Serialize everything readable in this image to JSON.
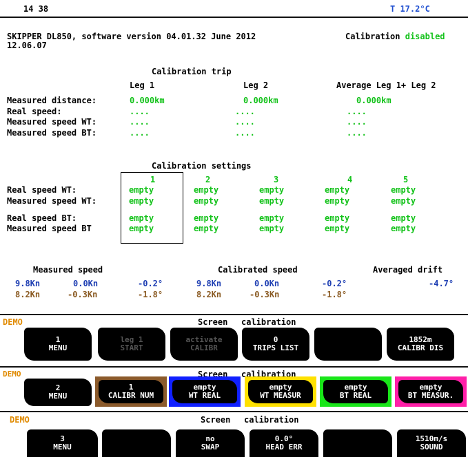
{
  "status": {
    "time": "14 38",
    "temperature": "T 17.2°C"
  },
  "header": {
    "software_line1": "SKIPPER DL850, software version 04.01.32 June 2012",
    "software_line2": "12.06.07",
    "calibration_label": "Calibration",
    "calibration_state": "disabled"
  },
  "trip": {
    "title": "Calibration trip",
    "col_headers": [
      "Leg 1",
      "Leg 2",
      "Average Leg 1+ Leg 2"
    ],
    "rows": [
      {
        "label": "Measured distance:",
        "values": [
          "0.000km",
          "0.000km",
          "0.000km"
        ]
      },
      {
        "label": "Real speed:",
        "values": [
          "....",
          "....",
          "...."
        ]
      },
      {
        "label": "Measured speed WT:",
        "values": [
          "....",
          "....",
          "...."
        ]
      },
      {
        "label": "Measured speed BT:",
        "values": [
          "....",
          "....",
          "...."
        ]
      }
    ]
  },
  "settings": {
    "title": "Calibration settings",
    "col_headers": [
      "1",
      "2",
      "3",
      "4",
      "5"
    ],
    "rows": [
      {
        "label": "Real speed WT:",
        "values": [
          "empty",
          "empty",
          "empty",
          "empty",
          "empty"
        ]
      },
      {
        "label": "Measured speed WT:",
        "values": [
          "empty",
          "empty",
          "empty",
          "empty",
          "empty"
        ]
      },
      {
        "label": "Real speed BT:",
        "values": [
          "empty",
          "empty",
          "empty",
          "empty",
          "empty"
        ]
      },
      {
        "label": "Measured speed BT",
        "values": [
          "empty",
          "empty",
          "empty",
          "empty",
          "empty"
        ]
      }
    ]
  },
  "speeds": {
    "measured_title": "Measured speed",
    "calibrated_title": "Calibrated speed",
    "drift_title": "Averaged drift",
    "row1": {
      "m_speed": "9.8Kn",
      "m_cross": "0.0Kn",
      "m_angle": "-0.2°",
      "c_speed": "9.8Kn",
      "c_cross": "0.0Kn",
      "c_angle": "-0.2°",
      "drift": "-4.7°"
    },
    "row2": {
      "m_speed": "8.2Kn",
      "m_cross": "-0.3Kn",
      "m_angle": "-1.8°",
      "c_speed": "8.2Kn",
      "c_cross": "-0.3Kn",
      "c_angle": "-1.8°"
    }
  },
  "panel1": {
    "demo": "DEMO",
    "screen": "Screen",
    "name": "calibration",
    "buttons": [
      {
        "l1": "1",
        "l2": "MENU"
      },
      {
        "l1": "leg 1",
        "l2": "START"
      },
      {
        "l1": "activate",
        "l2": "CALIBR"
      },
      {
        "l1": "0",
        "l2": "TRIPS LIST"
      },
      {
        "l1": "",
        "l2": ""
      },
      {
        "l1": "1852m",
        "l2": "CALIBR DIS"
      }
    ]
  },
  "panel2": {
    "demo": "DEMO",
    "screen": "Screen",
    "name": "calibration",
    "buttons": [
      {
        "l1": "2",
        "l2": "MENU"
      },
      {
        "l1": "1",
        "l2": "CALIBR NUM"
      },
      {
        "l1": "empty",
        "l2": "WT REAL"
      },
      {
        "l1": "empty",
        "l2": "WT MEASUR"
      },
      {
        "l1": "empty",
        "l2": "BT REAL"
      },
      {
        "l1": "empty",
        "l2": "BT MEASUR."
      }
    ],
    "frame_colors": [
      "#8b5a2b",
      "#1020ff",
      "#ffe100",
      "#19e619",
      "#ff1fa8"
    ]
  },
  "panel3": {
    "demo": "DEMO",
    "screen": "Screen",
    "name": "calibration",
    "buttons": [
      {
        "l1": "3",
        "l2": "MENU"
      },
      {
        "l1": "",
        "l2": ""
      },
      {
        "l1": "no",
        "l2": "SWAP"
      },
      {
        "l1": "0.0°",
        "l2": "HEAD ERR"
      },
      {
        "l1": "",
        "l2": ""
      },
      {
        "l1": "1510m/s",
        "l2": "SOUND"
      }
    ]
  }
}
